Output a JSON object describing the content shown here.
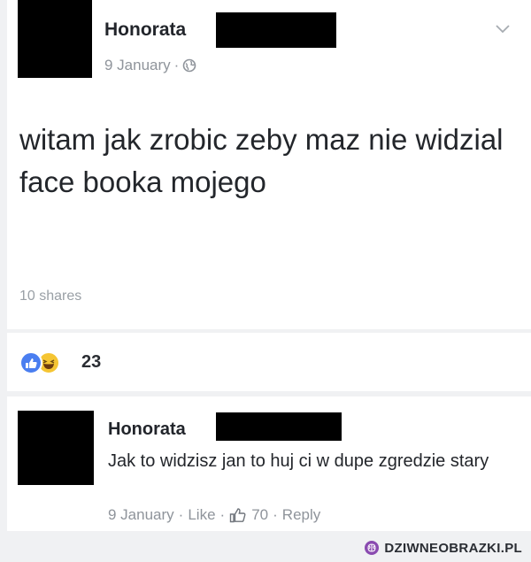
{
  "post": {
    "author": "Honorata",
    "date": "9 January",
    "separator": "·",
    "body": "witam jak zrobic zeby maz nie widzial face booka mojego",
    "shares": "10 shares",
    "menu_icon": "chevron-down-icon",
    "privacy_icon": "globe-icon"
  },
  "reactions": {
    "icons": [
      "like-reaction-icon",
      "haha-reaction-icon"
    ],
    "count": "23"
  },
  "comment": {
    "author": "Honorata",
    "text": "Jak to widzisz jan to huj ci w dupe zgredzie stary",
    "date": "9 January",
    "like_label": "Like",
    "like_count": "70",
    "reply_label": "Reply",
    "separator": "·"
  },
  "watermark": {
    "text": "DZIWNEOBRAZKI.PL"
  },
  "colors": {
    "like_blue": "#4a7ef0",
    "haha_yellow": "#f5c533",
    "meta_gray": "#8f949b",
    "redaction": "#000000"
  }
}
